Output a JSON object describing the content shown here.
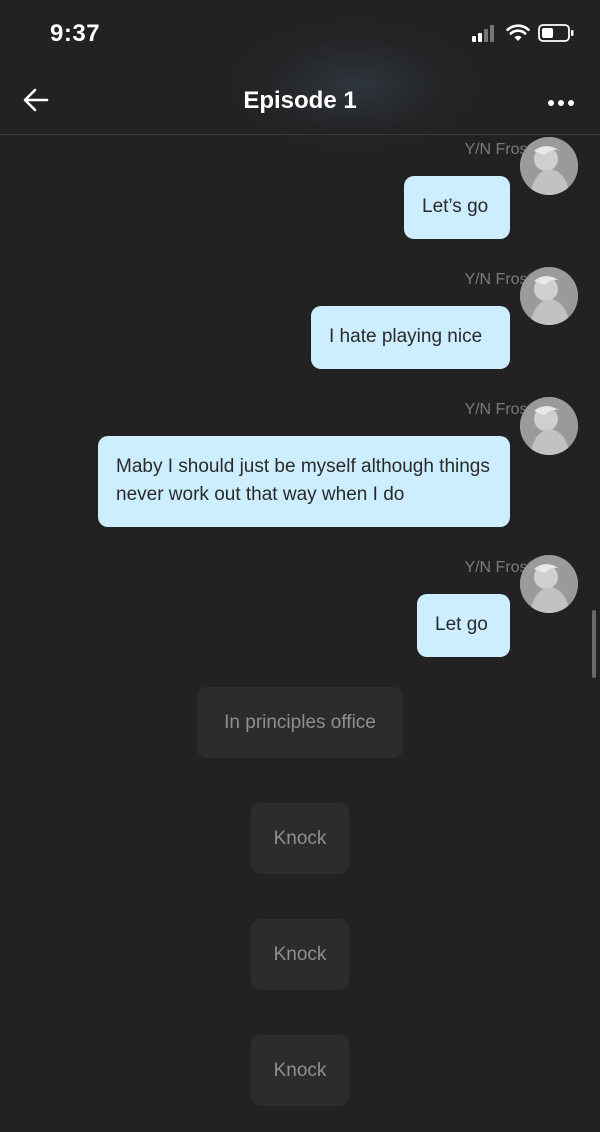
{
  "status_bar": {
    "time": "9:37",
    "icons": [
      "cellular-signal-icon",
      "wifi-icon",
      "battery-icon"
    ]
  },
  "header": {
    "title": "Episode 1",
    "back_icon": "arrow-left-icon",
    "more_icon": "more-horizontal-icon"
  },
  "messages": [
    {
      "sender": "Y/N Frost",
      "text": "Let’s go"
    },
    {
      "sender": "Y/N Frost",
      "text": "I hate playing nice"
    },
    {
      "sender": "Y/N Frost",
      "text": "Maby I should just be myself although things never work out that way when I do"
    },
    {
      "sender": "Y/N Frost",
      "text": "Let go"
    }
  ],
  "narrations": [
    {
      "text": "In principles office"
    },
    {
      "text": "Knock"
    },
    {
      "text": "Knock"
    },
    {
      "text": "Knock"
    }
  ],
  "colors": {
    "background": "#222222",
    "bubble": "#cdeeff",
    "narration_bg": "#2c2c2c",
    "sender_name": "#7a7a7a"
  }
}
